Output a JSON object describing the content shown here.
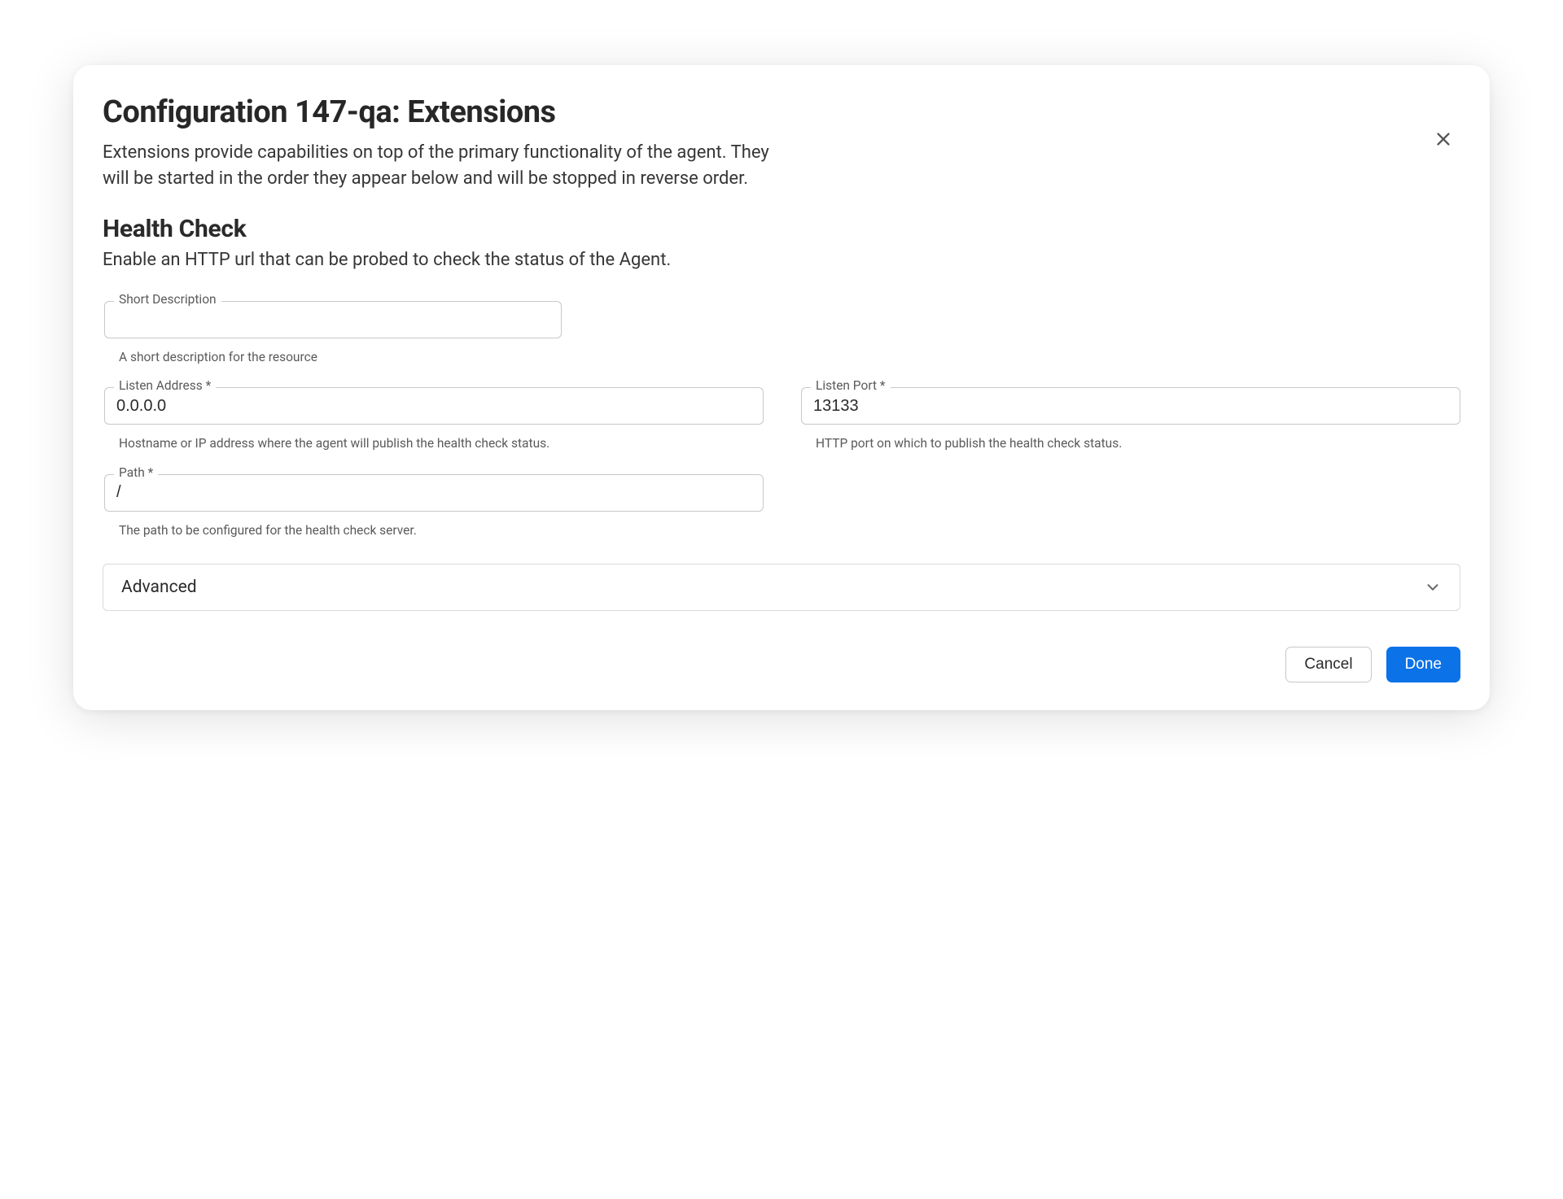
{
  "dialog": {
    "title": "Configuration 147-qa: Extensions",
    "subtitle": "Extensions provide capabilities on top of the primary functionality of the agent. They will be started in the order they appear below and will be stopped in reverse order."
  },
  "section": {
    "title": "Health Check",
    "description": "Enable an HTTP url that can be probed to check the status of the Agent."
  },
  "fields": {
    "short_description": {
      "label": "Short Description",
      "value": "",
      "helper": "A short description for the resource"
    },
    "listen_address": {
      "label": "Listen Address *",
      "value": "0.0.0.0",
      "helper": "Hostname or IP address where the agent will publish the health check status."
    },
    "listen_port": {
      "label": "Listen Port *",
      "value": "13133",
      "helper": "HTTP port on which to publish the health check status."
    },
    "path": {
      "label": "Path *",
      "value": "/",
      "helper": "The path to be configured for the health check server."
    }
  },
  "accordion": {
    "label": "Advanced"
  },
  "footer": {
    "cancel": "Cancel",
    "done": "Done"
  }
}
